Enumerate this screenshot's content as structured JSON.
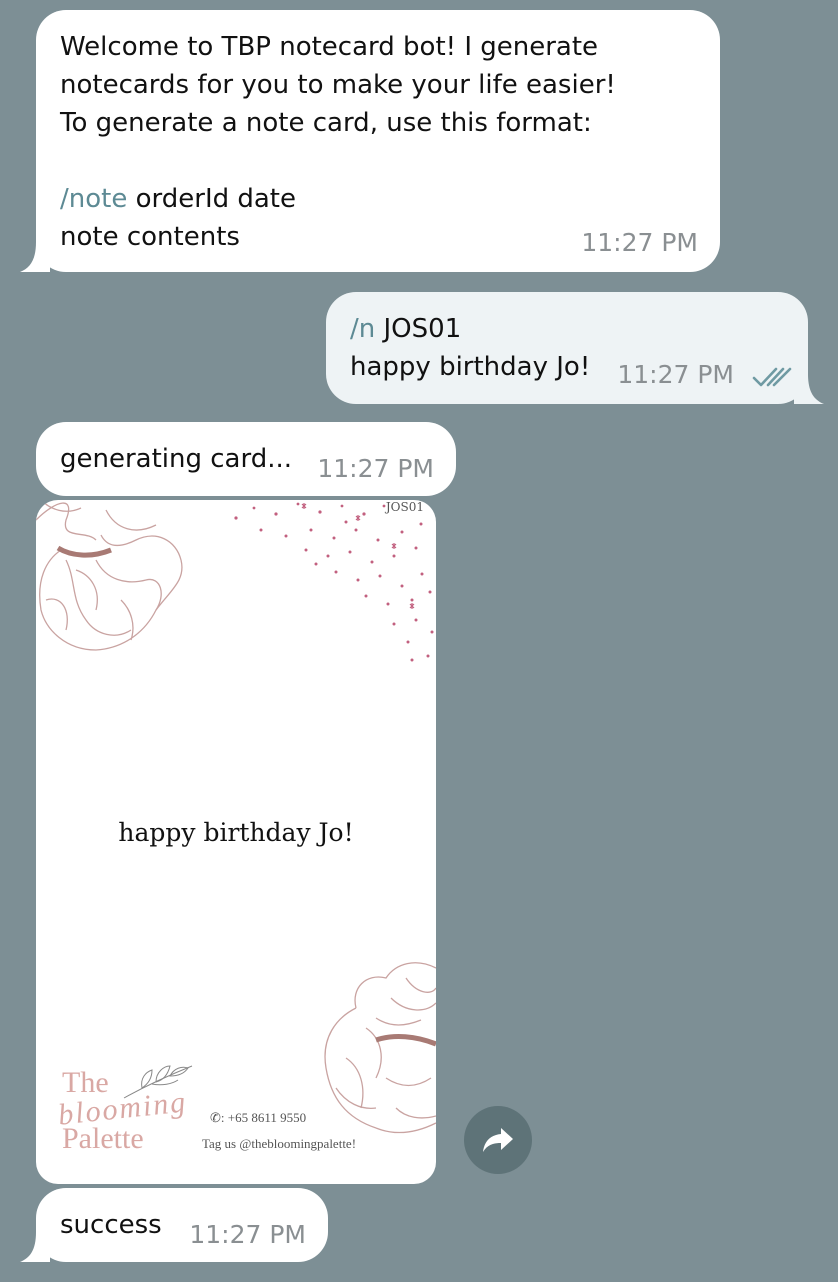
{
  "messages": {
    "welcome": {
      "line1": "Welcome to TBP notecard bot! I generate",
      "line2": "notecards for you to make your life easier!",
      "line3": "To generate a note card, use this format:",
      "cmd": "/note",
      "format_rest": " orderId date",
      "line5": "note contents",
      "time": "11:27 PM"
    },
    "user": {
      "cmd": "/n",
      "order": " JOS01",
      "line2": "happy birthday Jo!",
      "time": "11:27 PM",
      "status_icon": "double-check-icon"
    },
    "generating": {
      "text": "generating card...",
      "time": "11:27 PM"
    },
    "card": {
      "order_id": "JOS01",
      "message": "happy birthday Jo!",
      "brand_line1": "The",
      "brand_line2": "blooming",
      "brand_line3": "Palette",
      "phone": "✆: +65 8611 9550",
      "tag": "Tag us @thebloomingpalette!"
    },
    "forward_icon": "forward-arrow-icon",
    "success": {
      "text": "success",
      "time": "11:27 PM"
    }
  },
  "colors": {
    "background": "#7d8f95",
    "bubble_in": "#ffffff",
    "bubble_out": "#eef3f5",
    "command": "#5d8a94",
    "timestamp": "#8a8f92",
    "floral": "#c9a3a1",
    "dots": "#c2607f"
  }
}
